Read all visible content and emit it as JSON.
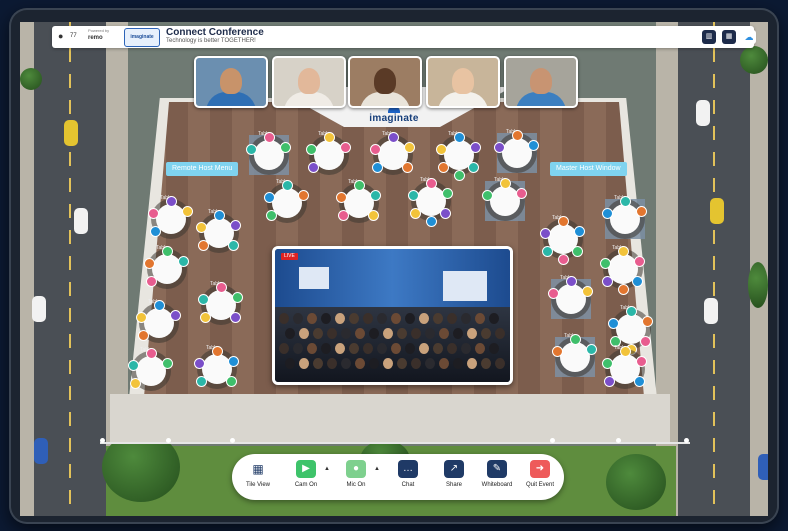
{
  "header": {
    "powered_by": "Powered by",
    "powered_brand": "remo",
    "brand_badge": "imaginate",
    "title": "Connect Conference",
    "subtitle": "Technology is better TOGETHER!",
    "user_icon": "user-icon",
    "count_label": "77"
  },
  "venue": {
    "logo": "imaginate",
    "sign_left": "Remote Host Menu",
    "sign_right": "Master Host Window",
    "table_label": "Table"
  },
  "participants": [
    {
      "name": "participant-1",
      "bg": "#6b8fb0",
      "skin": "#c8936a",
      "shirt": "#2f6fb4"
    },
    {
      "name": "participant-2",
      "bg": "#d7d2c8",
      "skin": "#e2b89a",
      "shirt": "#f0ece6"
    },
    {
      "name": "participant-3",
      "bg": "#9c7d63",
      "skin": "#5a3a26",
      "shirt": "#e9e4da"
    },
    {
      "name": "participant-4",
      "bg": "#c8b59a",
      "skin": "#e8c3a2",
      "shirt": "#f3f1ec"
    },
    {
      "name": "participant-5",
      "bg": "#a6a49b",
      "skin": "#c89472",
      "shirt": "#3c7fc0"
    }
  ],
  "stage": {
    "live_badge": "LIVE"
  },
  "toolbar": {
    "tile_view": "Tile View",
    "cam_on": "Cam On",
    "mic_on": "Mic On",
    "chat": "Chat",
    "share": "Share",
    "whiteboard": "Whiteboard",
    "quit_event": "Quit Event"
  },
  "colors": {
    "cam": "#3ec36a",
    "mic": "#7ed08e",
    "chat": "#1f3a66",
    "share": "#1f3a66",
    "whiteboard": "#1f3a66",
    "quit": "#ee5a5a",
    "tile": "#1f3a66"
  }
}
